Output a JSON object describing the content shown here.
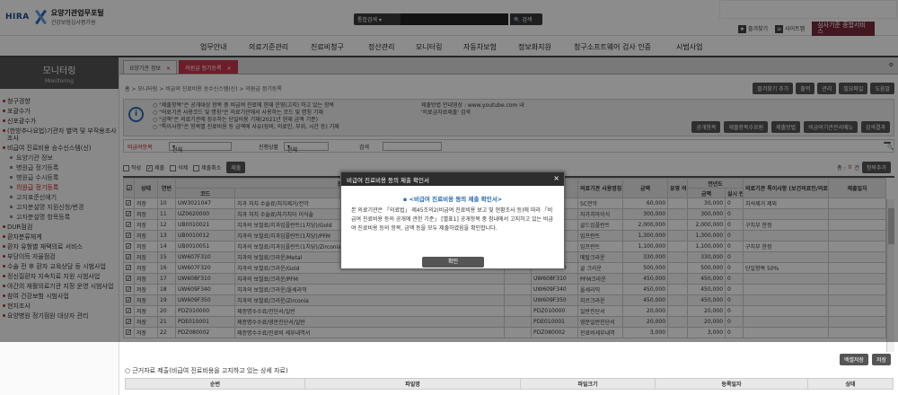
{
  "header": {
    "logo_brand": "HIRA",
    "logo_title": "요양기관업무포털",
    "logo_sub": "건강보험심사평가원",
    "search_select": "통합검색",
    "search_btn": "검색",
    "link_fav": "즐겨찾기",
    "link_sitemap": "사이트맵",
    "cta": "심사기준 종합서비스"
  },
  "gnb": [
    "업무안내",
    "의료기준관리",
    "진료비청구",
    "정산관리",
    "모니터링",
    "자동차보험",
    "정보화지원",
    "청구소프트웨어 검사 인증",
    "시범사업"
  ],
  "sidebar": {
    "title": "모니터링",
    "subtitle": "Monitoring",
    "items": [
      {
        "label": "청구경향",
        "type": "main"
      },
      {
        "label": "포괄수가",
        "type": "main"
      },
      {
        "label": "신포괄수가",
        "type": "main"
      },
      {
        "label": "(한방추나요법)기관자 별역 및 부작용조사 조사",
        "type": "main"
      },
      {
        "label": "비급여 진료비용 승수신스템(신)",
        "type": "main"
      },
      {
        "label": "요양기관 정보",
        "type": "sub"
      },
      {
        "label": "병원급 정기등록",
        "type": "sub"
      },
      {
        "label": "병원급 수시등록",
        "type": "sub"
      },
      {
        "label": "의원급 정기등록",
        "type": "sub",
        "active": true
      },
      {
        "label": "고지표준신에기",
        "type": "sub"
      },
      {
        "label": "고자분설명 지원신청/변경",
        "type": "sub"
      },
      {
        "label": "고자분설명 항목등록",
        "type": "sub"
      },
      {
        "label": "DUR점검",
        "type": "main"
      },
      {
        "label": "환자분류체계",
        "type": "main"
      },
      {
        "label": "환자 유형별 재택의료 서비스",
        "type": "main"
      },
      {
        "label": "부당이득 자율점검",
        "type": "main"
      },
      {
        "label": "수술 전 후 환자 교육상담 등 시범사업",
        "type": "main"
      },
      {
        "label": "정신질환자 지속치료 지원 시범사업",
        "type": "main"
      },
      {
        "label": "야간의 재활의료기관 지정 운영 시범사업",
        "type": "main"
      },
      {
        "label": "참여 건강보험 시범사업",
        "type": "main"
      },
      {
        "label": "현지조사",
        "type": "main"
      },
      {
        "label": "요양병원 정기점원 대상자 관리",
        "type": "main"
      }
    ]
  },
  "tabs": [
    {
      "label": "요양기관 정보"
    },
    {
      "label": "의원급 정기등록",
      "active": true
    }
  ],
  "breadcrumb": "홈 > 모니터링 > 비급여 진료비용 승수신스템(신) > 의원급 정기등록",
  "topbuttons": [
    "즐겨찾기 추가",
    "출력",
    "관리",
    "필요파일",
    "도움말"
  ],
  "info": {
    "lines": [
      "○ \"제출항목\"은 공개대상 항목 중 비급여 진료에 현재 운영(고지) 하고 있는 항목",
      "○ \"의료기관 사용코드 및 명칭\"은 의료기관에서 사용하는 코드 및 명칭 기재",
      "○ \"금액\"은 의료기관에 징수하는 단일비용 기재(2021년 현재 금액 기준)",
      "○ \"특이사항\"은 항목별 진료비용 등 금액에 사유(장비, 의료인, 부위, 시간 등) 기재"
    ],
    "yt_1": "제출방법 안내영상 : www.youtube.com 내",
    "yt_2": "'의료급자료제출' 검색",
    "buttons": [
      "공개항목",
      "제출항목수요원",
      "제출방법",
      "비급여기관관서메뉴",
      "검색결과"
    ]
  },
  "filter": {
    "l1": "비급여항목",
    "s1": "전체",
    "l2": "진행상황",
    "s2": "전체",
    "l3": "검색",
    "search_btn": "조회"
  },
  "checks": {
    "c1": "작성",
    "c2": "제출",
    "c3": "삭제",
    "c4": "제출취소",
    "btn": "제출",
    "total_label": "총 :",
    "total_count": "0",
    "total_unit": "건",
    "add": "항목추가"
  },
  "grid": {
    "h_state": "상태",
    "h_seq": "연번",
    "h_code": "코드",
    "h_group": "분",
    "h_name": "명칭",
    "h_ord": "",
    "h_mcode": "",
    "h_tcode": "코드",
    "h_mname": "의료기관 사용명칭",
    "h_amt": "금액",
    "h_yn": "유영 여부",
    "h_amt2": "금액",
    "h_real": "실시 빈도",
    "h_note": "의료기관 특이사항 (보건의료인/의료기기 등)",
    "h_date": "제출일자",
    "h_prev": "전년도",
    "rows": [
      {
        "state": "저장",
        "seq": "10",
        "code": "UW3021047",
        "name": "치과 처치 수술료/처치제거/전악",
        "mcode": "",
        "tcode": "",
        "mname": "SC전악",
        "amt": "60,000",
        "amt2": "30,000",
        "real": "0",
        "note": "치석제거 제외"
      },
      {
        "state": "저장",
        "seq": "11",
        "code": "UZ0620000",
        "name": "치과 처치 수술료/자가치아 이식술",
        "mcode": "",
        "tcode": "",
        "mname": "자가치아이식",
        "amt": "300,000",
        "amt2": "300,000",
        "real": "0",
        "note": ""
      },
      {
        "state": "저장",
        "seq": "12",
        "code": "UB0010021",
        "name": "치과의 보철료/치과임플란트(1치당)/Gold",
        "mcode": "",
        "tcode": "",
        "mname": "골드임플란트",
        "amt": "2,000,000",
        "amt2": "2,000,000",
        "real": "0",
        "note": "구치부 한정"
      },
      {
        "state": "저장",
        "seq": "13",
        "code": "UB0010012",
        "name": "치과의 보철료/치과임플란트(1치당)/PFM",
        "mcode": "",
        "tcode": "",
        "mname": "임프란트",
        "amt": "1,300,000",
        "amt2": "1,300,000",
        "real": "0",
        "note": ""
      },
      {
        "state": "저장",
        "seq": "14",
        "code": "UB0010051",
        "name": "치과의 보철료/치과임플란트(1치당)/Zirconia",
        "mcode": "",
        "tcode": "",
        "mname": "임프란트",
        "amt": "1,100,000",
        "amt2": "1,100,000",
        "real": "0",
        "note": "구치부 한정"
      },
      {
        "state": "저장",
        "seq": "15",
        "code": "UW607F310",
        "name": "치과의 보철료/크라운/Metal",
        "mcode": "",
        "tcode": "",
        "mname": "메탈크라운",
        "amt": "330,000",
        "amt2": "330,000",
        "real": "0",
        "note": ""
      },
      {
        "state": "저장",
        "seq": "16",
        "code": "UW607F320",
        "name": "치과의 보철료/크라운/Gold",
        "mcode": "",
        "tcode": "UW607F320",
        "mname": "골 크라운",
        "amt": "500,000",
        "amt2": "500,000",
        "real": "0",
        "note": "단일항목 50%"
      },
      {
        "state": "저장",
        "seq": "17",
        "code": "UW608F310",
        "name": "치과의 보철료/크라운/PFM",
        "mcode": "",
        "tcode": "UW608F310",
        "mname": "PFM크라운",
        "amt": "450,000",
        "amt2": "450,000",
        "real": "0",
        "note": ""
      },
      {
        "state": "저장",
        "seq": "18",
        "code": "UW609F340",
        "name": "치과의 보철료/크라운/올세라믹",
        "mcode": "",
        "tcode": "UW609F340",
        "mname": "올세라믹",
        "amt": "450,000",
        "amt2": "450,000",
        "real": "0",
        "note": ""
      },
      {
        "state": "저장",
        "seq": "19",
        "code": "UW609F350",
        "name": "치과의 보철료/크라운/Zirconia",
        "mcode": "",
        "tcode": "UW609F350",
        "mname": "지르크라운",
        "amt": "450,000",
        "amt2": "450,000",
        "real": "0",
        "note": ""
      },
      {
        "state": "저장",
        "seq": "20",
        "code": "PDZ010000",
        "name": "제증명수수료/진단서/일반",
        "mcode": "",
        "tcode": "PDZ010000",
        "mname": "일반진단서",
        "amt": "20,000",
        "amt2": "20,000",
        "real": "0",
        "note": ""
      },
      {
        "state": "저장",
        "seq": "21",
        "code": "PDE010001",
        "name": "제증명수수료/영문진단서/일반",
        "mcode": "",
        "tcode": "PDE010001",
        "mname": "영문일반진단서",
        "amt": "20,000",
        "amt2": "20,000",
        "real": "0",
        "note": ""
      },
      {
        "state": "저장",
        "seq": "22",
        "code": "PDZ080002",
        "name": "제증명수수료/진료비 세부내역서",
        "mcode": "",
        "tcode": "PDZ080002",
        "mname": "진료비세부내역",
        "amt": "3,000",
        "amt2": "3,000",
        "real": "0",
        "note": ""
      }
    ]
  },
  "bottom": {
    "b1": "엑셀저장",
    "b2": "저장",
    "title": "○ 근거자료 제출(비급여 진료비용을 고지하고 있는 상세 자료)",
    "cols": [
      "순번",
      "파일명",
      "파일크기",
      "등록일자",
      "상태"
    ]
  },
  "modal": {
    "title": "비급여 진료비용 등의 제출 확인서",
    "close": "×",
    "subtitle": "<비급여 진료비용 등의 제출 확인서>",
    "body": "본 의료기관은 「의료법」 제45조의2(비급여 진료비용 보고 및 현황조사 등)에 따라 「비급여 진료비용 등의 공개에 관한 기준」 [별표1] 공개항목 중 참내에서 고지하고 있는 비급여 진료비용 등의 항목, 금액 등을 모두 제출하였음을 확인합니다.",
    "ok": "확인"
  }
}
